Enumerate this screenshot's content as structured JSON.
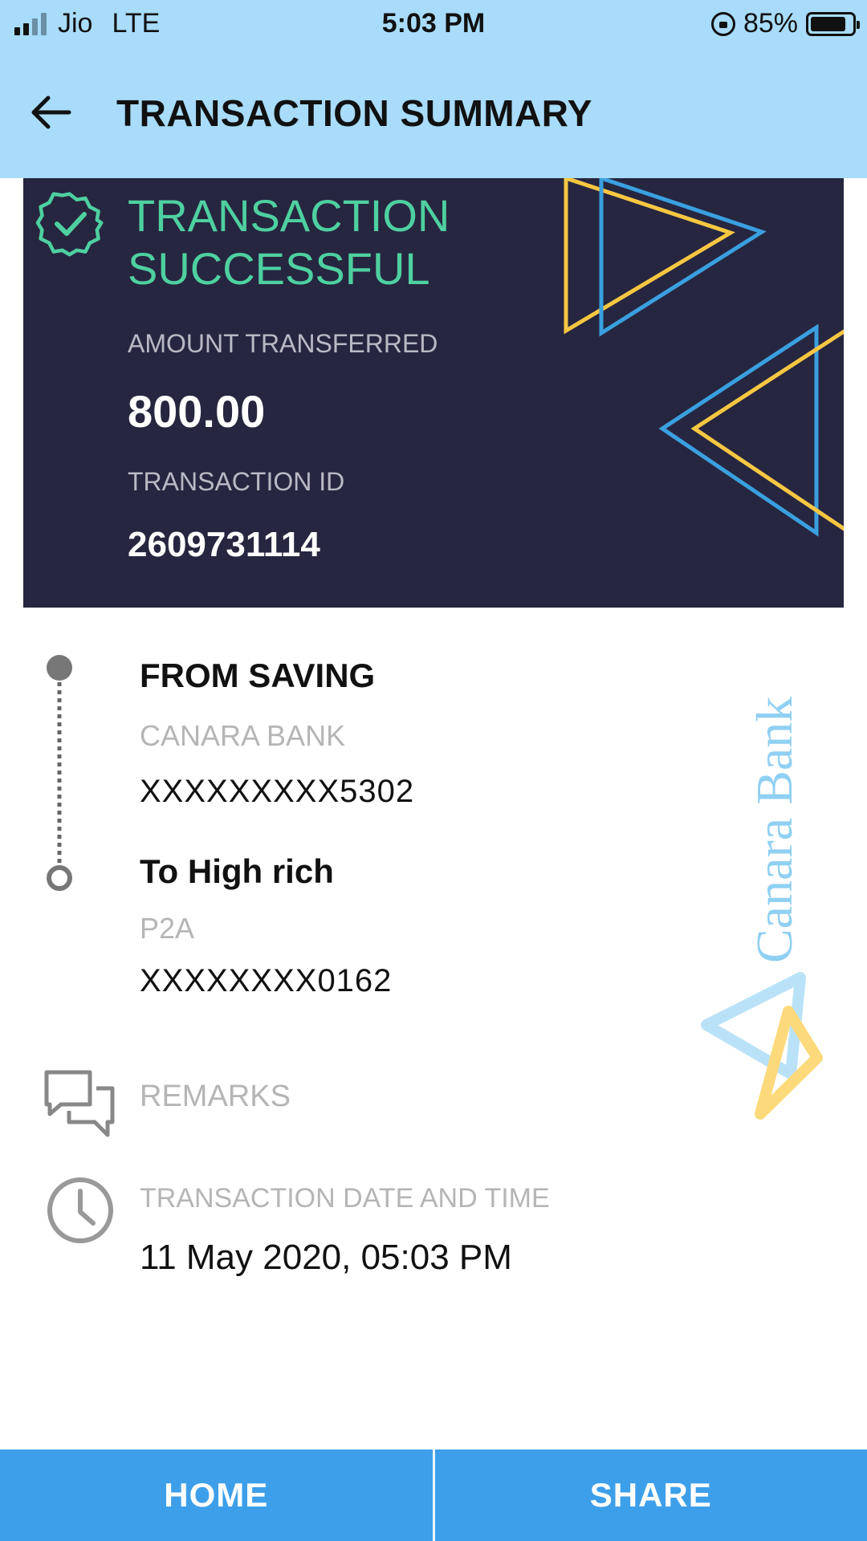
{
  "status_bar": {
    "carrier": "Jio",
    "network": "LTE",
    "time": "5:03 PM",
    "battery": "85%",
    "battery_level": 0.85
  },
  "header": {
    "title": "TRANSACTION SUMMARY",
    "back_icon": "arrow-left-icon"
  },
  "summary": {
    "status": "TRANSACTION SUCCESSFUL",
    "status_icon": "check-circle-icon",
    "amount_label": "AMOUNT TRANSFERRED",
    "amount": "800.00",
    "txid_label": "TRANSACTION ID",
    "txid": "2609731114"
  },
  "transfer": {
    "from_title": "FROM SAVING",
    "from_bank": "CANARA BANK",
    "from_account": "XXXXXXXXX5302",
    "to_title": "To High rich",
    "to_type": "P2A",
    "to_account": "XXXXXXXX0162"
  },
  "watermark": {
    "text": "Canara Bank"
  },
  "remarks": {
    "label": "REMARKS",
    "icon": "chat-bubbles-icon"
  },
  "datetime": {
    "label": "TRANSACTION DATE AND TIME",
    "value": "11 May 2020, 05:03 PM",
    "icon": "clock-icon"
  },
  "bottom_bar": {
    "home": "HOME",
    "share": "SHARE"
  },
  "colors": {
    "header_bg": "#a8dcfa",
    "card_bg": "#262640",
    "success_green": "#4ed0a0",
    "button_blue": "#3d9fea",
    "accent_yellow": "#f7c742",
    "accent_blue": "#3aa0e0"
  }
}
